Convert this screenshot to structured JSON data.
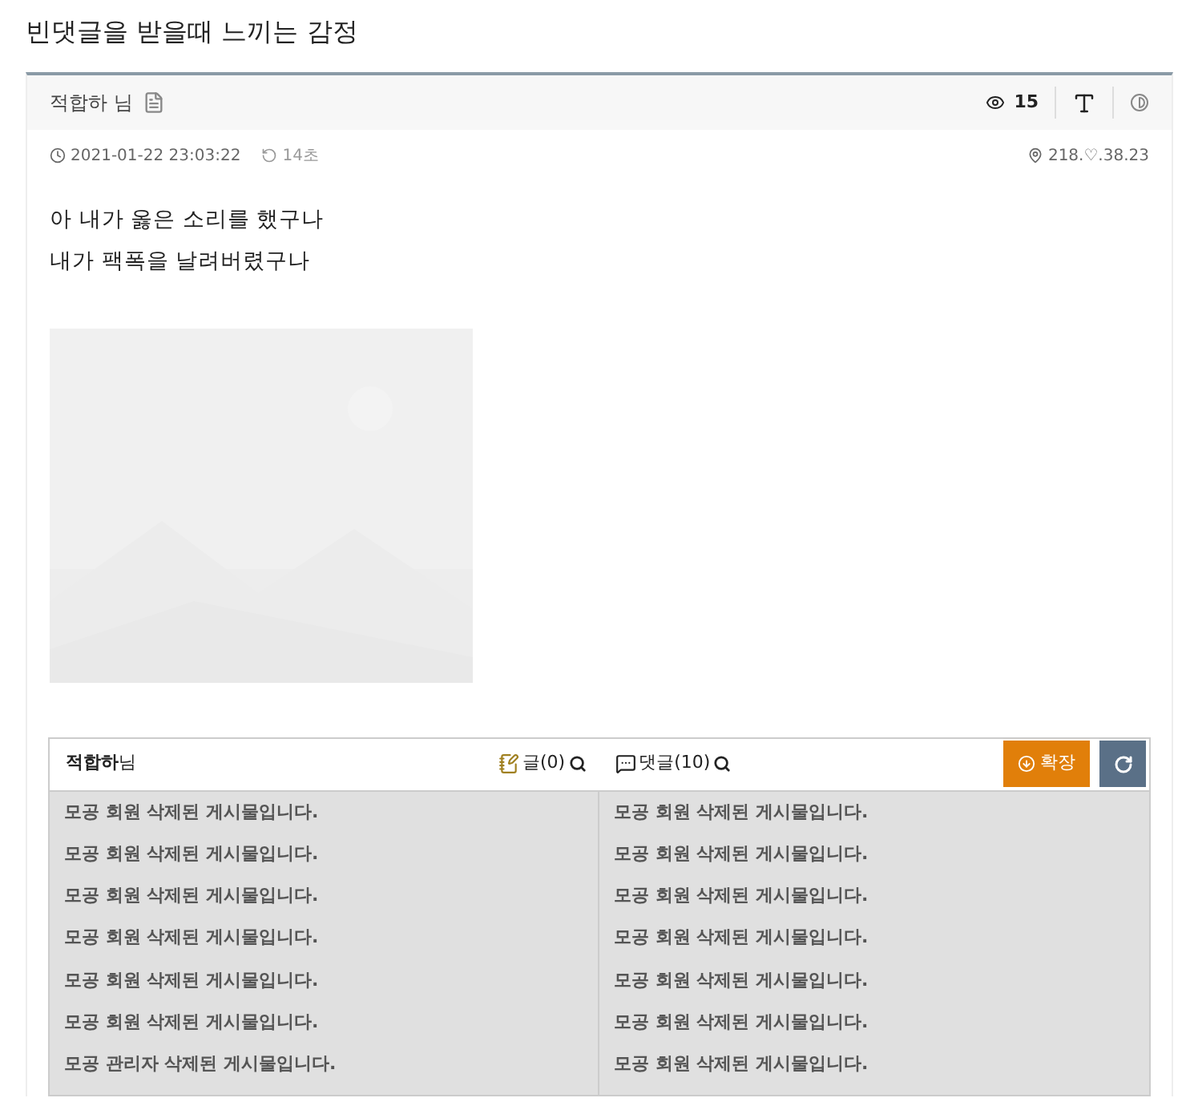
{
  "title": "빈댓글을 받을때 느끼는 감정",
  "post_header": {
    "author": "적합하 님",
    "views": "15"
  },
  "meta": {
    "datetime": "2021-01-22 23:03:22",
    "elapsed": "14초",
    "ip": "218.♡.38.23"
  },
  "body": [
    "아 내가 옳은 소리를 했구나",
    "내가 팩폭을 날려버렸구나"
  ],
  "member_box": {
    "name": "**적합하**님",
    "posts_label": "글(0)",
    "comments_label": "댓글(10)",
    "expand_button": "확장",
    "posts": [
      "모공 회원 삭제된 게시물입니다.",
      "모공 회원 삭제된 게시물입니다.",
      "모공 회원 삭제된 게시물입니다.",
      "모공 회원 삭제된 게시물입니다.",
      "모공 회원 삭제된 게시물입니다.",
      "모공 회원 삭제된 게시물입니다.",
      "모공 관리자 삭제된 게시물입니다."
    ],
    "comments": [
      "모공 회원 삭제된 게시물입니다.",
      "모공 회원 삭제된 게시물입니다.",
      "모공 회원 삭제된 게시물입니다.",
      "모공 회원 삭제된 게시물입니다.",
      "모공 회원 삭제된 게시물입니다.",
      "모공 회원 삭제된 게시물입니다.",
      "모공 회원 삭제된 게시물입니다."
    ]
  }
}
